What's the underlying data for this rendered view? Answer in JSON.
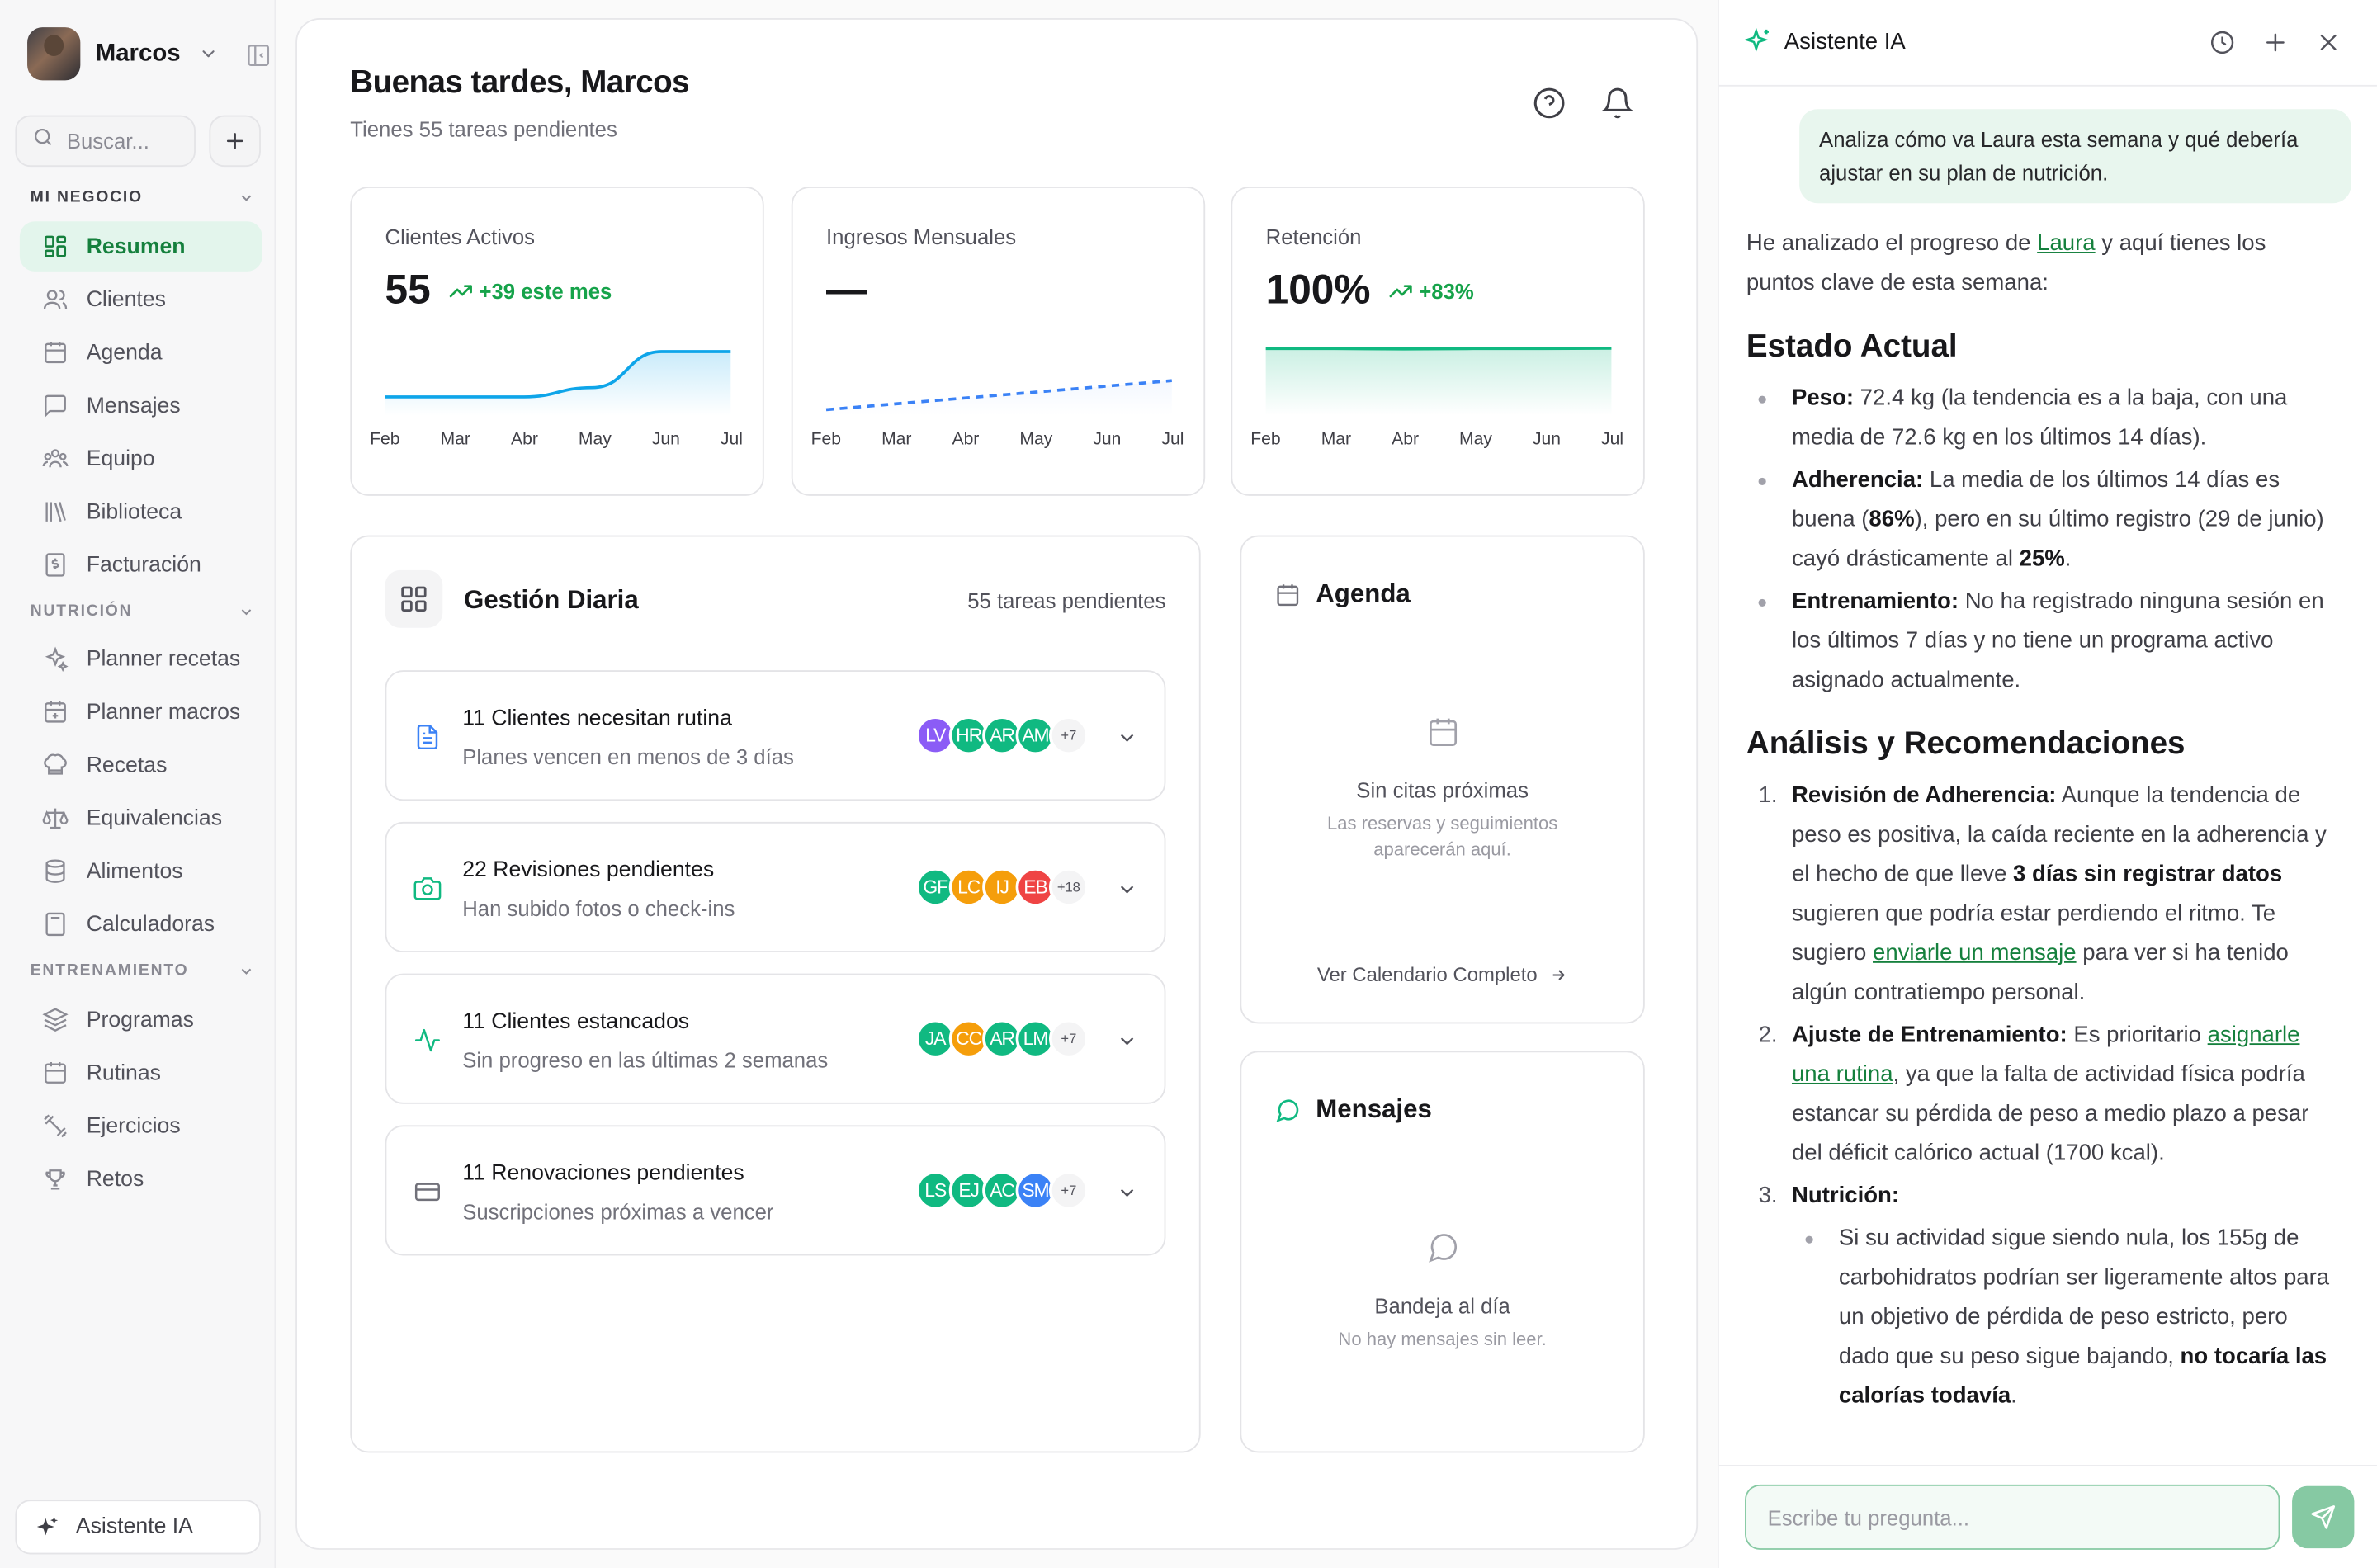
{
  "user": {
    "name": "Marcos"
  },
  "search": {
    "placeholder": "Buscar..."
  },
  "sections": {
    "business": "MI NEGOCIO",
    "nutrition": "NUTRICIÓN",
    "training": "ENTRENAMIENTO"
  },
  "nav": {
    "business": [
      {
        "label": "Resumen",
        "icon": "grid-icon",
        "active": true
      },
      {
        "label": "Clientes",
        "icon": "users-icon"
      },
      {
        "label": "Agenda",
        "icon": "calendar-icon"
      },
      {
        "label": "Mensajes",
        "icon": "message-icon"
      },
      {
        "label": "Equipo",
        "icon": "team-icon"
      },
      {
        "label": "Biblioteca",
        "icon": "library-icon"
      },
      {
        "label": "Facturación",
        "icon": "invoice-icon"
      }
    ],
    "nutrition": [
      {
        "label": "Planner recetas",
        "icon": "sparkles-icon"
      },
      {
        "label": "Planner macros",
        "icon": "calendar-plus-icon"
      },
      {
        "label": "Recetas",
        "icon": "chef-hat-icon"
      },
      {
        "label": "Equivalencias",
        "icon": "scale-icon"
      },
      {
        "label": "Alimentos",
        "icon": "database-icon"
      },
      {
        "label": "Calculadoras",
        "icon": "calculator-icon"
      }
    ],
    "training": [
      {
        "label": "Programas",
        "icon": "layers-icon"
      },
      {
        "label": "Rutinas",
        "icon": "calendar-icon"
      },
      {
        "label": "Ejercicios",
        "icon": "dumbbell-icon"
      },
      {
        "label": "Retos",
        "icon": "trophy-icon"
      }
    ]
  },
  "sidebar_ai": {
    "label": "Asistente IA"
  },
  "header": {
    "greeting": "Buenas tardes, Marcos",
    "subtitle": "Tienes 55 tareas pendientes"
  },
  "stats": [
    {
      "title": "Clientes Activos",
      "value": "55",
      "trend": "+39 este mes",
      "color": "#0ea5e9"
    },
    {
      "title": "Ingresos Mensuales",
      "value": "—",
      "trend": "",
      "color": "#3b82f6"
    },
    {
      "title": "Retención",
      "value": "100%",
      "trend": "+83%",
      "color": "#10b981"
    }
  ],
  "months": [
    "Feb",
    "Mar",
    "Abr",
    "May",
    "Jun",
    "Jul"
  ],
  "chart_data": [
    {
      "type": "area",
      "title": "Clientes Activos",
      "x": [
        "Feb",
        "Mar",
        "Abr",
        "May",
        "Jun",
        "Jul"
      ],
      "series": [
        {
          "values": [
            16,
            16,
            16,
            24,
            55,
            55
          ]
        }
      ],
      "ylim": [
        0,
        60
      ]
    },
    {
      "type": "line",
      "title": "Ingresos Mensuales",
      "x": [
        "Feb",
        "Mar",
        "Abr",
        "May",
        "Jun",
        "Jul"
      ],
      "series": [
        {
          "values": [
            1,
            2,
            3,
            4,
            5,
            6
          ]
        }
      ],
      "ylim": [
        0,
        12
      ]
    },
    {
      "type": "area",
      "title": "Retención",
      "x": [
        "Feb",
        "Mar",
        "Abr",
        "May",
        "Jun",
        "Jul"
      ],
      "series": [
        {
          "values": [
            96,
            96,
            95.5,
            96,
            96,
            96.5
          ]
        }
      ],
      "ylim": [
        0,
        100
      ]
    }
  ],
  "daily": {
    "title": "Gestión Diaria",
    "count": "55 tareas pendientes",
    "tasks": [
      {
        "title": "11 Clientes necesitan rutina",
        "subtitle": "Planes vencen en menos de 3 días",
        "icon": "document-icon",
        "icon_color": "#3b82f6",
        "avatars": [
          {
            "i": "LV",
            "c": "#8b5cf6"
          },
          {
            "i": "HR",
            "c": "#10b981"
          },
          {
            "i": "AR",
            "c": "#10b981"
          },
          {
            "i": "AM",
            "c": "#10b981"
          }
        ],
        "more": "+7"
      },
      {
        "title": "22 Revisiones pendientes",
        "subtitle": "Han subido fotos o check-ins",
        "icon": "camera-icon",
        "icon_color": "#10b981",
        "avatars": [
          {
            "i": "GF",
            "c": "#10b981"
          },
          {
            "i": "LC",
            "c": "#f59e0b"
          },
          {
            "i": "IJ",
            "c": "#f59e0b"
          },
          {
            "i": "EB",
            "c": "#ef4444"
          }
        ],
        "more": "+18"
      },
      {
        "title": "11 Clientes estancados",
        "subtitle": "Sin progreso en las últimas 2 semanas",
        "icon": "activity-icon",
        "icon_color": "#10b981",
        "avatars": [
          {
            "i": "JA",
            "c": "#10b981"
          },
          {
            "i": "CC",
            "c": "#f59e0b"
          },
          {
            "i": "AR",
            "c": "#10b981"
          },
          {
            "i": "LM",
            "c": "#10b981"
          }
        ],
        "more": "+7"
      },
      {
        "title": "11 Renovaciones pendientes",
        "subtitle": "Suscripciones próximas a vencer",
        "icon": "credit-card-icon",
        "icon_color": "#71717a",
        "avatars": [
          {
            "i": "LS",
            "c": "#10b981"
          },
          {
            "i": "EJ",
            "c": "#10b981"
          },
          {
            "i": "AC",
            "c": "#10b981"
          },
          {
            "i": "SM",
            "c": "#3b82f6"
          }
        ],
        "more": "+7"
      }
    ]
  },
  "agenda": {
    "title": "Agenda",
    "empty_title": "Sin citas próximas",
    "empty_sub_1": "Las reservas y seguimientos",
    "empty_sub_2": "aparecerán aquí.",
    "link": "Ver Calendario Completo"
  },
  "messages": {
    "title": "Mensajes",
    "empty_title": "Bandeja al día",
    "empty_sub": "No hay mensajes sin leer."
  },
  "assistant": {
    "title": "Asistente IA",
    "user_message": "Analiza cómo va Laura esta semana y qué debería ajustar en su plan de nutrición.",
    "intro_pre": "He analizado el progreso de ",
    "intro_link": "Laura",
    "intro_post": " y aquí tienes los puntos clave de esta semana:",
    "h1": "Estado Actual",
    "bullets": [
      {
        "bold": "Peso:",
        "text": " 72.4 kg (la tendencia es a la baja, con una media de 72.6 kg en los últimos 14 días)."
      },
      {
        "bold": "Adherencia:",
        "text_a": " La media de los últimos 14 días es buena (",
        "bold2": "86%",
        "text_b": "), pero en su último registro (29 de junio) cayó drásticamente al ",
        "bold3": "25%",
        "text_c": "."
      },
      {
        "bold": "Entrenamiento:",
        "text": " No ha registrado ninguna sesión en los últimos 7 días y no tiene un programa activo asignado actualmente."
      }
    ],
    "h2": "Análisis y Recomendaciones",
    "rec1": {
      "bold": "Revisión de Adherencia:",
      "text_a": " Aunque la tendencia de peso es positiva, la caída reciente en la adherencia y el hecho de que lleve ",
      "bold2": "3 días sin registrar datos",
      "text_b": " sugieren que podría estar perdiendo el ritmo. Te sugiero ",
      "link": "enviarle un mensaje",
      "text_c": " para ver si ha tenido algún contratiempo personal."
    },
    "rec2": {
      "bold": "Ajuste de Entrenamiento:",
      "text_a": " Es prioritario ",
      "link": "asignarle una rutina",
      "text_b": ", ya que la falta de actividad física podría estancar su pérdida de peso a medio plazo a pesar del déficit calórico actual (1700 kcal)."
    },
    "rec3": {
      "bold": "Nutrición:",
      "sub_text": "Si su actividad sigue siendo nula, los 155g de carbohidratos podrían ser ligeramente altos para un objetivo de pérdida de peso estricto, pero dado que su peso sigue bajando, ",
      "sub_bold": "no tocaría las calorías todavía",
      "sub_end": "."
    },
    "input_placeholder": "Escribe tu pregunta..."
  }
}
